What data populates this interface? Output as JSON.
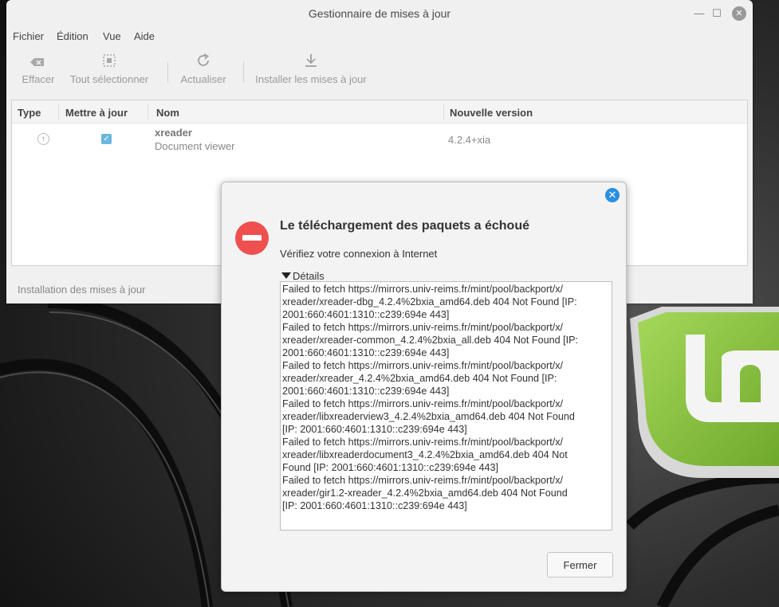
{
  "window": {
    "title": "Gestionnaire de mises à jour",
    "minimize_glyph": "—",
    "maximize_glyph": "☐",
    "close_glyph": "✕"
  },
  "menu": [
    "Fichier",
    "Édition",
    "Vue",
    "Aide"
  ],
  "toolbar": {
    "clear": "Effacer",
    "select_all": "Tout sélectionner",
    "refresh": "Actualiser",
    "install": "Installer les mises à jour"
  },
  "table": {
    "headers": [
      "Type",
      "Mettre à jour",
      "Nom",
      "Nouvelle version"
    ],
    "rows": [
      {
        "type_icon": "↑",
        "checked_glyph": "✓",
        "name": "xreader",
        "description": "Document viewer",
        "version": "4.2.4+xia"
      }
    ]
  },
  "status": "Installation des mises à jour",
  "dialog": {
    "close_glyph": "✕",
    "title": "Le téléchargement des paquets a échoué",
    "message": "Vérifiez votre connexion à Internet",
    "details_label": "Détails",
    "details_lines": [
      "Failed to fetch https://mirrors.univ-reims.fr/mint/pool/backport/x/",
      "xreader/xreader-dbg_4.2.4%2bxia_amd64.deb 404  Not Found [IP:",
      "2001:660:4601:1310::c239:694e 443]",
      "Failed to fetch https://mirrors.univ-reims.fr/mint/pool/backport/x/",
      "xreader/xreader-common_4.2.4%2bxia_all.deb 404  Not Found [IP:",
      "2001:660:4601:1310::c239:694e 443]",
      "Failed to fetch https://mirrors.univ-reims.fr/mint/pool/backport/x/",
      "xreader/xreader_4.2.4%2bxia_amd64.deb 404  Not Found [IP:",
      "2001:660:4601:1310::c239:694e 443]",
      "Failed to fetch https://mirrors.univ-reims.fr/mint/pool/backport/x/",
      "xreader/libxreaderview3_4.2.4%2bxia_amd64.deb 404  Not Found",
      "[IP: 2001:660:4601:1310::c239:694e 443]",
      "Failed to fetch https://mirrors.univ-reims.fr/mint/pool/backport/x/",
      "xreader/libxreaderdocument3_4.2.4%2bxia_amd64.deb 404  Not",
      "Found [IP: 2001:660:4601:1310::c239:694e 443]",
      "Failed to fetch https://mirrors.univ-reims.fr/mint/pool/backport/x/",
      "xreader/gir1.2-xreader_4.2.4%2bxia_amd64.deb 404  Not Found",
      "[IP: 2001:660:4601:1310::c239:694e 443]"
    ],
    "close_button": "Fermer"
  },
  "colors": {
    "error": "#ef4f4f",
    "accent": "#2a8fe0",
    "checkbox": "#6ab7df",
    "mint_green": "#8cc63e"
  }
}
